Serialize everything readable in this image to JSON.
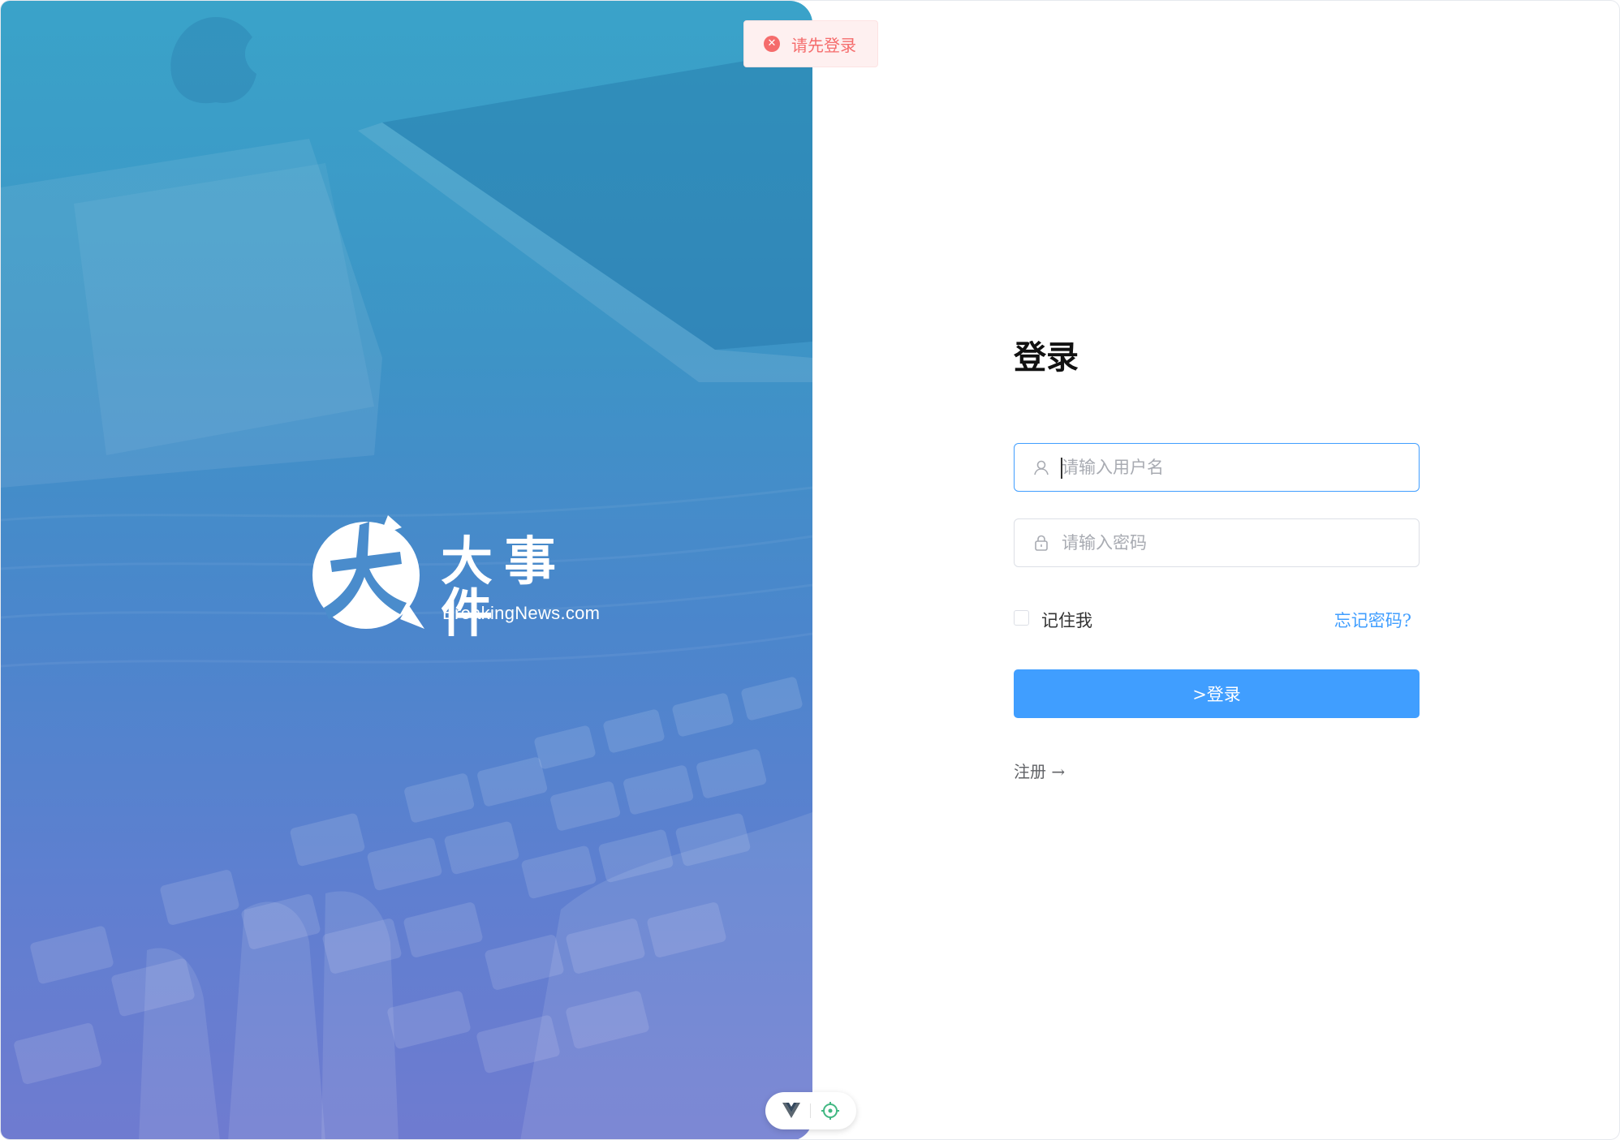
{
  "toast": {
    "message": "请先登录",
    "icon": "error-circle-icon",
    "color": "#f56c6c"
  },
  "hero": {
    "brand_title": "大事件",
    "brand_subtitle": "BreakingNews.com",
    "logo_icon": "breaking-news-logo-icon"
  },
  "login": {
    "title": "登录",
    "username_placeholder": "请输入用户名",
    "username_value": "",
    "password_placeholder": "请输入密码",
    "password_value": "",
    "remember_label": "记住我",
    "remember_checked": false,
    "forgot_label": "忘记密码?",
    "submit_label": ">登录",
    "register_label": "注册 →"
  },
  "colors": {
    "accent": "#409eff",
    "error": "#f56c6c",
    "hero_gradient_top": "#3aa3c9",
    "hero_gradient_bottom": "#6f7bd0"
  },
  "devtools": {
    "vue_icon": "vue-logo-icon",
    "inspect_icon": "crosshair-icon"
  }
}
